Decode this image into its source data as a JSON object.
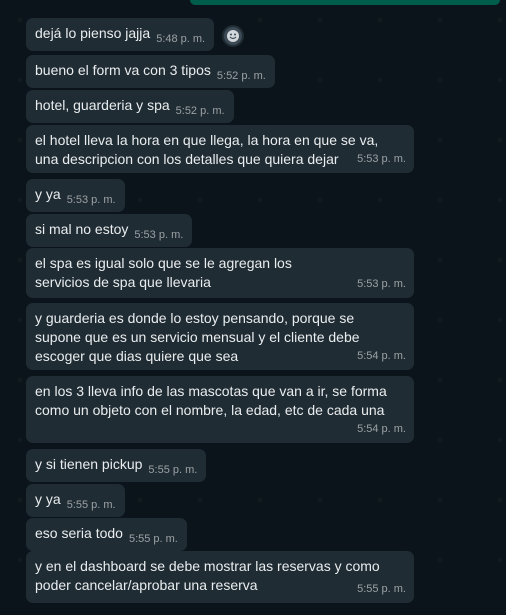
{
  "messages": [
    {
      "text": "dejá lo pienso jajja",
      "time": "5:48 p. m."
    },
    {
      "text": "bueno el form va con 3 tipos",
      "time": "5:52 p. m."
    },
    {
      "text": "hotel, guarderia y spa",
      "time": "5:52 p. m."
    },
    {
      "text": "el hotel lleva la hora en que llega, la hora en que se va, una descripcion con los detalles que quiera dejar",
      "time": "5:53 p. m."
    },
    {
      "text": "y ya",
      "time": "5:53 p. m."
    },
    {
      "text": "si mal no estoy",
      "time": "5:53 p. m."
    },
    {
      "text": "el spa es igual solo que se le agregan los servicios de spa que llevaria",
      "time": "5:53 p. m."
    },
    {
      "text": "y guarderia es donde lo estoy pensando, porque se supone que es un servicio mensual y el cliente debe escoger que dias quiere que sea",
      "time": "5:54 p. m."
    },
    {
      "text": "en los 3 lleva info de las mascotas que van a ir, se forma como un objeto con el nombre, la edad, etc de cada una",
      "time": "5:54 p. m."
    },
    {
      "text": "y si tienen pickup",
      "time": "5:55 p. m."
    },
    {
      "text": "y ya",
      "time": "5:55 p. m."
    },
    {
      "text": "eso seria todo",
      "time": "5:55 p. m."
    },
    {
      "text": "y en el dashboard se debe mostrar las reservas y como poder cancelar/aprobar una reserva",
      "time": "5:55 p. m."
    }
  ],
  "icons": {
    "emoji": "smiley-icon"
  },
  "colors": {
    "bubble": "#202c33",
    "background": "#0b141a",
    "text": "#e9edef",
    "accent": "#005c4b"
  }
}
